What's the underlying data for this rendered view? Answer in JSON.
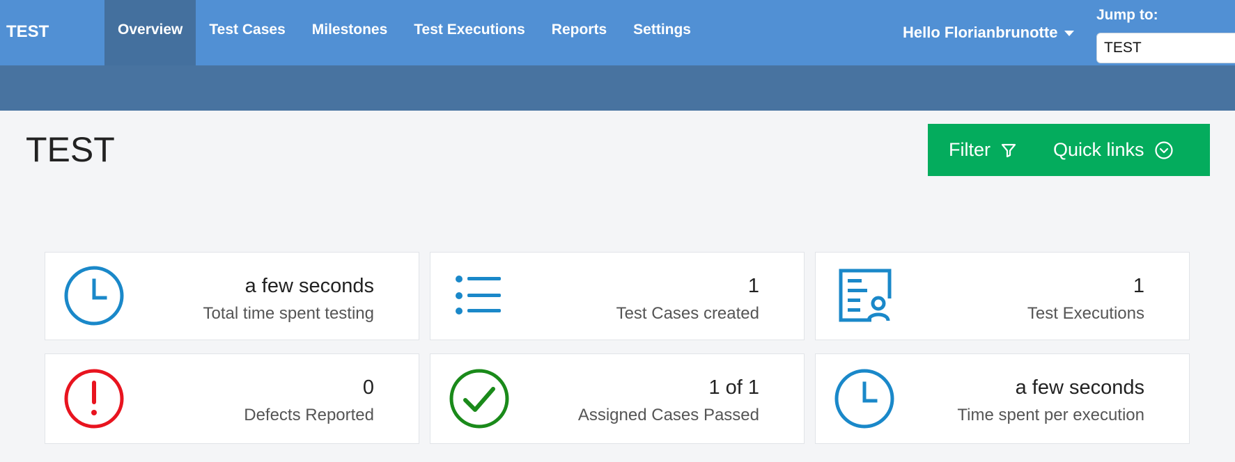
{
  "topbar": {
    "brand": "TEST",
    "nav": [
      {
        "label": "Overview",
        "active": true
      },
      {
        "label": "Test Cases",
        "active": false
      },
      {
        "label": "Milestones",
        "active": false
      },
      {
        "label": "Test Executions",
        "active": false
      },
      {
        "label": "Reports",
        "active": false
      },
      {
        "label": "Settings",
        "active": false
      }
    ],
    "user_greeting": "Hello Florianbrunotte",
    "jump_label": "Jump to:",
    "jump_value": "TEST"
  },
  "page": {
    "title": "TEST",
    "filter_label": "Filter",
    "quick_links_label": "Quick links"
  },
  "stats": [
    {
      "value": "a few seconds",
      "label": "Total time spent testing",
      "icon": "clock-icon",
      "color": "#1a88c9"
    },
    {
      "value": "1",
      "label": "Test Cases created",
      "icon": "list-icon",
      "color": "#1a88c9"
    },
    {
      "value": "1",
      "label": "Test Executions",
      "icon": "document-user-icon",
      "color": "#1a88c9"
    },
    {
      "value": "0",
      "label": "Defects Reported",
      "icon": "alert-circle-icon",
      "color": "#e8141f"
    },
    {
      "value": "1 of 1",
      "label": "Assigned Cases Passed",
      "icon": "check-circle-icon",
      "color": "#1a8a1a"
    },
    {
      "value": "a few seconds",
      "label": "Time spent per execution",
      "icon": "clock-icon",
      "color": "#1a88c9"
    }
  ],
  "colors": {
    "topbar": "#5190d4",
    "subbar": "#4873a0",
    "active_tab": "#44709e",
    "action_green": "#04ac5d"
  }
}
